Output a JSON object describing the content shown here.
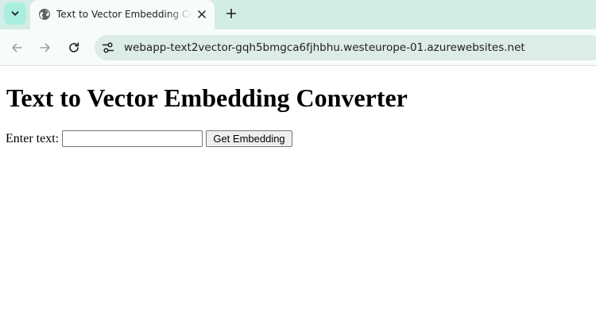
{
  "browser": {
    "tab": {
      "title": "Text to Vector Embedding Converter"
    },
    "address_bar": {
      "url": "webapp-text2vector-gqh5bmgca6fjhbhu.westeurope-01.azurewebsites.net"
    }
  },
  "page": {
    "heading": "Text to Vector Embedding Converter",
    "form": {
      "label": "Enter text:",
      "input_value": "",
      "submit_label": "Get Embedding"
    }
  },
  "icons": {
    "tab_search": "chevron-down-icon",
    "favicon": "globe-icon",
    "tab_close": "close-icon",
    "new_tab": "plus-icon",
    "back": "arrow-left-icon",
    "forward": "arrow-right-icon",
    "reload": "reload-icon",
    "site_info": "tune-icon"
  },
  "colors": {
    "tabstrip_bg": "#d3ece6",
    "tab_search_bg": "#a8efe0",
    "omnibox_bg": "#dcece7"
  }
}
